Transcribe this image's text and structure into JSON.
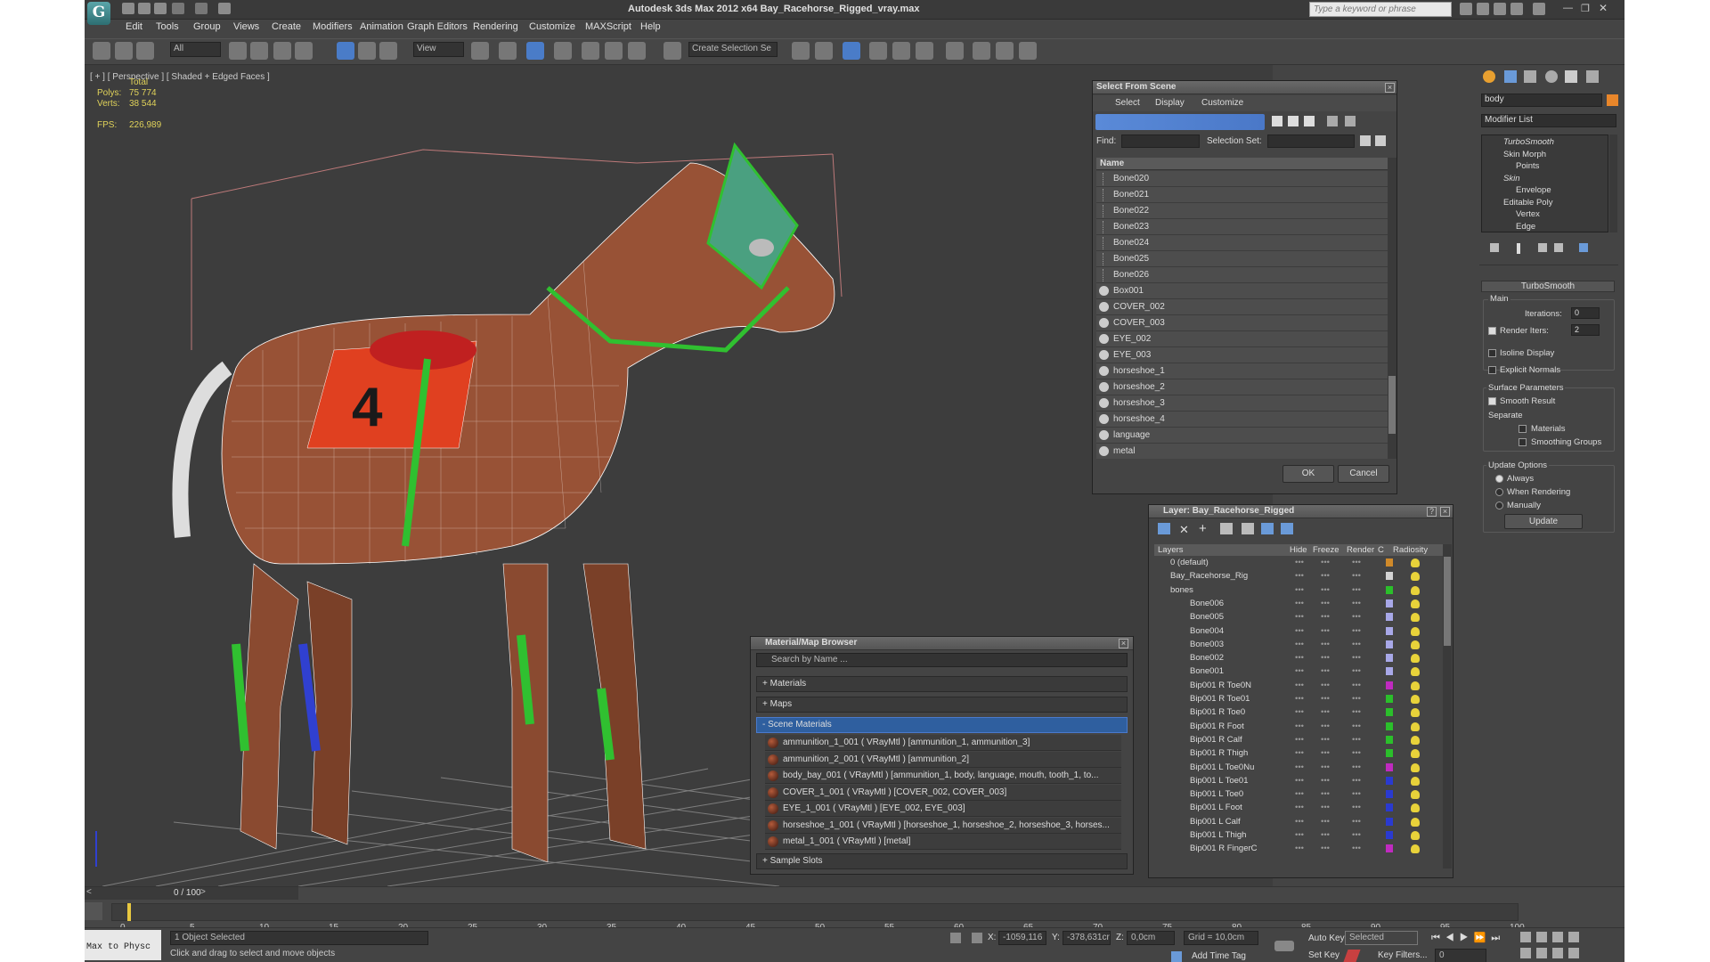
{
  "app": {
    "title": "Autodesk 3ds Max  2012 x64     Bay_Racehorse_Rigged_vray.max",
    "logo": "G",
    "search_placeholder": "Type a keyword or phrase"
  },
  "menu": [
    "Edit",
    "Tools",
    "Group",
    "Views",
    "Create",
    "Modifiers",
    "Animation",
    "Graph Editors",
    "Rendering",
    "Customize",
    "MAXScript",
    "Help"
  ],
  "toolbar": {
    "selection_filter": "All",
    "ref_coord": "View",
    "selection_set": "Create Selection Se"
  },
  "viewport": {
    "label": "[ + ] [ Perspective ] [ Shaded + Edged Faces ]",
    "stats_header": "Total",
    "polys_label": "Polys:",
    "polys": "75 774",
    "verts_label": "Verts:",
    "verts": "38 544",
    "fps_label": "FPS:",
    "fps": "226,989",
    "saddle_number": "4"
  },
  "select_from_scene": {
    "title": "Select From Scene",
    "menus": [
      "Select",
      "Display",
      "Customize"
    ],
    "find_label": "Find:",
    "selection_set_label": "Selection Set:",
    "column_name": "Name",
    "rows": [
      {
        "name": "Bone020",
        "type": "bone"
      },
      {
        "name": "Bone021",
        "type": "bone"
      },
      {
        "name": "Bone022",
        "type": "bone"
      },
      {
        "name": "Bone023",
        "type": "bone"
      },
      {
        "name": "Bone024",
        "type": "bone"
      },
      {
        "name": "Bone025",
        "type": "bone"
      },
      {
        "name": "Bone026",
        "type": "bone"
      },
      {
        "name": "Box001",
        "type": "geo"
      },
      {
        "name": "COVER_002",
        "type": "geo"
      },
      {
        "name": "COVER_003",
        "type": "geo"
      },
      {
        "name": "EYE_002",
        "type": "geo"
      },
      {
        "name": "EYE_003",
        "type": "geo"
      },
      {
        "name": "horseshoe_1",
        "type": "geo"
      },
      {
        "name": "horseshoe_2",
        "type": "geo"
      },
      {
        "name": "horseshoe_3",
        "type": "geo"
      },
      {
        "name": "horseshoe_4",
        "type": "geo"
      },
      {
        "name": "language",
        "type": "geo"
      },
      {
        "name": "metal",
        "type": "geo"
      }
    ],
    "ok": "OK",
    "cancel": "Cancel"
  },
  "layer_panel": {
    "title": "Layer: Bay_Racehorse_Rigged",
    "help": "?",
    "columns": [
      "Layers",
      "Hide",
      "Freeze",
      "Render",
      "C",
      "Radiosity"
    ],
    "rows": [
      {
        "name": "0 (default)",
        "color": "#d08a2a",
        "indent": 0
      },
      {
        "name": "Bay_Racehorse_Rig",
        "color": "#d3d3d3",
        "indent": 0
      },
      {
        "name": "bones",
        "color": "#2bbf2b",
        "indent": 0
      },
      {
        "name": "Bone006",
        "color": "#a8a8e8",
        "indent": 1
      },
      {
        "name": "Bone005",
        "color": "#a8a8e8",
        "indent": 1
      },
      {
        "name": "Bone004",
        "color": "#a8a8e8",
        "indent": 1
      },
      {
        "name": "Bone003",
        "color": "#a8a8e8",
        "indent": 1
      },
      {
        "name": "Bone002",
        "color": "#a8a8e8",
        "indent": 1
      },
      {
        "name": "Bone001",
        "color": "#a8a8e8",
        "indent": 1
      },
      {
        "name": "Bip001 R Toe0N",
        "color": "#c02ac0",
        "indent": 1
      },
      {
        "name": "Bip001 R Toe01",
        "color": "#2bbf2b",
        "indent": 1
      },
      {
        "name": "Bip001 R Toe0",
        "color": "#2bbf2b",
        "indent": 1
      },
      {
        "name": "Bip001 R Foot",
        "color": "#2bbf2b",
        "indent": 1
      },
      {
        "name": "Bip001 R Calf",
        "color": "#2bbf2b",
        "indent": 1
      },
      {
        "name": "Bip001 R Thigh",
        "color": "#2bbf2b",
        "indent": 1
      },
      {
        "name": "Bip001 L Toe0Nu",
        "color": "#c02ac0",
        "indent": 1
      },
      {
        "name": "Bip001 L Toe01",
        "color": "#2a3ad0",
        "indent": 1
      },
      {
        "name": "Bip001 L Toe0",
        "color": "#2a3ad0",
        "indent": 1
      },
      {
        "name": "Bip001 L Foot",
        "color": "#2a3ad0",
        "indent": 1
      },
      {
        "name": "Bip001 L Calf",
        "color": "#2a3ad0",
        "indent": 1
      },
      {
        "name": "Bip001 L Thigh",
        "color": "#2a3ad0",
        "indent": 1
      },
      {
        "name": "Bip001 R FingerC",
        "color": "#c02ac0",
        "indent": 1
      }
    ]
  },
  "material_browser": {
    "title": "Material/Map Browser",
    "search_placeholder": "Search by Name ...",
    "sections": [
      "+ Materials",
      "+ Maps",
      "- Scene Materials"
    ],
    "scene_materials": [
      "ammunition_1_001  ( VRayMtl )  [ammunition_1, ammunition_3]",
      "ammunition_2_001  ( VRayMtl )  [ammunition_2]",
      "body_bay_001  ( VRayMtl )  [ammunition_1, body, language, mouth, tooth_1, to...",
      "COVER_1_001  ( VRayMtl )  [COVER_002, COVER_003]",
      "EYE_1_001  ( VRayMtl )  [EYE_002, EYE_003]",
      "horseshoe_1_001  ( VRayMtl )  [horseshoe_1, horseshoe_2, horseshoe_3, horses...",
      "metal_1_001  ( VRayMtl )  [metal]"
    ],
    "sample_slots": "+ Sample Slots"
  },
  "command_panel": {
    "object_name": "body",
    "object_color": "#e8862a",
    "modifier_list": "Modifier List",
    "stack": [
      {
        "label": "TurboSmooth",
        "italic": true,
        "indent": 0
      },
      {
        "label": "Skin Morph",
        "italic": false,
        "indent": 0
      },
      {
        "label": "Points",
        "italic": false,
        "indent": 1
      },
      {
        "label": "Skin",
        "italic": true,
        "indent": 0
      },
      {
        "label": "Envelope",
        "italic": false,
        "indent": 1
      },
      {
        "label": "Editable Poly",
        "italic": false,
        "indent": 0
      },
      {
        "label": "Vertex",
        "italic": false,
        "indent": 1
      },
      {
        "label": "Edge",
        "italic": false,
        "indent": 1
      }
    ],
    "rollout_title": "TurboSmooth",
    "main": "Main",
    "iterations_label": "Iterations:",
    "iterations": "0",
    "render_iters_label": "Render Iters:",
    "render_iters": "2",
    "isoline_display": "Isoline Display",
    "explicit_normals": "Explicit Normals",
    "surface_parameters": "Surface Parameters",
    "smooth_result": "Smooth Result",
    "separate": "Separate",
    "materials": "Materials",
    "smoothing_groups": "Smoothing Groups",
    "update_options": "Update Options",
    "always": "Always",
    "when_rendering": "When Rendering",
    "manually": "Manually",
    "update": "Update"
  },
  "timeline": {
    "frame_counter": "0 / 100",
    "ticks": [
      "0",
      "5",
      "10",
      "15",
      "20",
      "25",
      "30",
      "35",
      "40",
      "45",
      "50",
      "55",
      "60",
      "65",
      "70",
      "75",
      "80",
      "85",
      "90",
      "95",
      "100"
    ]
  },
  "status": {
    "maxscript": "Max to Physc",
    "objects_selected": "1 Object Selected",
    "prompt": "Click and drag to select and move objects",
    "x_label": "X:",
    "x": "-1059,116",
    "y_label": "Y:",
    "y": "-378,631cr",
    "z_label": "Z:",
    "z": "0,0cm",
    "grid": "Grid = 10,0cm",
    "add_time_tag": "Add Time Tag",
    "auto_key": "Auto Key",
    "selected": "Selected",
    "set_key": "Set Key",
    "key_filters": "Key Filters...",
    "current_frame": "0"
  }
}
